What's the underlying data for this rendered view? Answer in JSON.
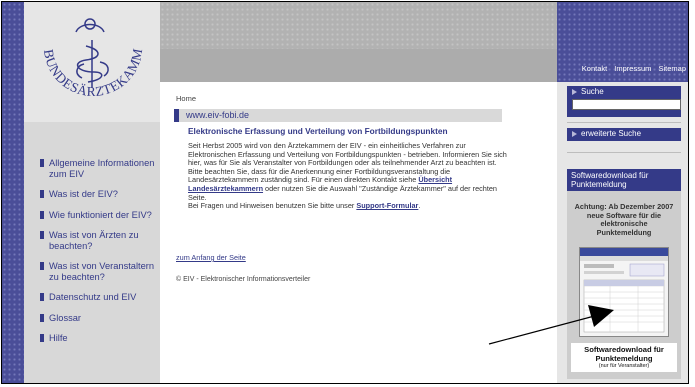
{
  "logo": {
    "text": "BUNDESÄRZTEKAMMER"
  },
  "top_links": [
    "Kontakt",
    "Impressum",
    "Sitemap"
  ],
  "nav": {
    "items": [
      "Allgemeine Informationen zum EIV",
      "Was ist der EIV?",
      "Wie funktioniert der EIV?",
      "Was ist von Ärzten zu beachten?",
      "Was ist von Veranstaltern zu beachten?",
      "Datenschutz und EIV",
      "Glossar",
      "Hilfe"
    ]
  },
  "main": {
    "breadcrumb": "Home",
    "site_title": "www.eiv-fobi.de",
    "heading": "Elektronische Erfassung und Verteilung von Fortbildungspunkten",
    "para1": "Seit Herbst 2005 wird von den Ärztekammern der EIV - ein einheitliches Verfahren zur Elektronischen Erfassung und Verteilung von Fortbildungspunkten - betrieben. Informieren Sie sich hier, was für Sie als Veranstalter von Fortbildungen oder als teilnehmender Arzt zu beachten ist.",
    "para2_before": "Bitte beachten Sie, dass für die Anerkennung einer Fortbildungsveranstaltung die Landesärztekammern zuständig sind. Für einen direkten Kontakt siehe ",
    "para2_link": "Übersicht Landesärztekammern",
    "para2_after": " oder nutzen Sie die Auswahl \"Zuständige Ärztekammer\" auf der rechten Seite.",
    "para3_before": "Bei Fragen und Hinweisen benutzen Sie bitte unser ",
    "para3_link": "Support-Formular",
    "para3_after": ".",
    "top_link": "zum Anfang der Seite",
    "footer": "© EIV - Elektronischer Informationsverteiler"
  },
  "sidebar": {
    "search_label": "Suche",
    "search_value": "",
    "advanced_search": "erweiterte Suche",
    "software_title": "Softwaredownload für Punktemeldung",
    "achtung": "Achtung: Ab Dezember 2007 neue Software für die elektronische Punktemeldung",
    "caption_main": "Softwaredownload für Punktemeldung",
    "caption_sub": "(nur für Veranstalter)"
  },
  "colors": {
    "brand_blue": "#343a88",
    "left_bg": "#d8d8d8",
    "header_grey": "#acacac"
  }
}
